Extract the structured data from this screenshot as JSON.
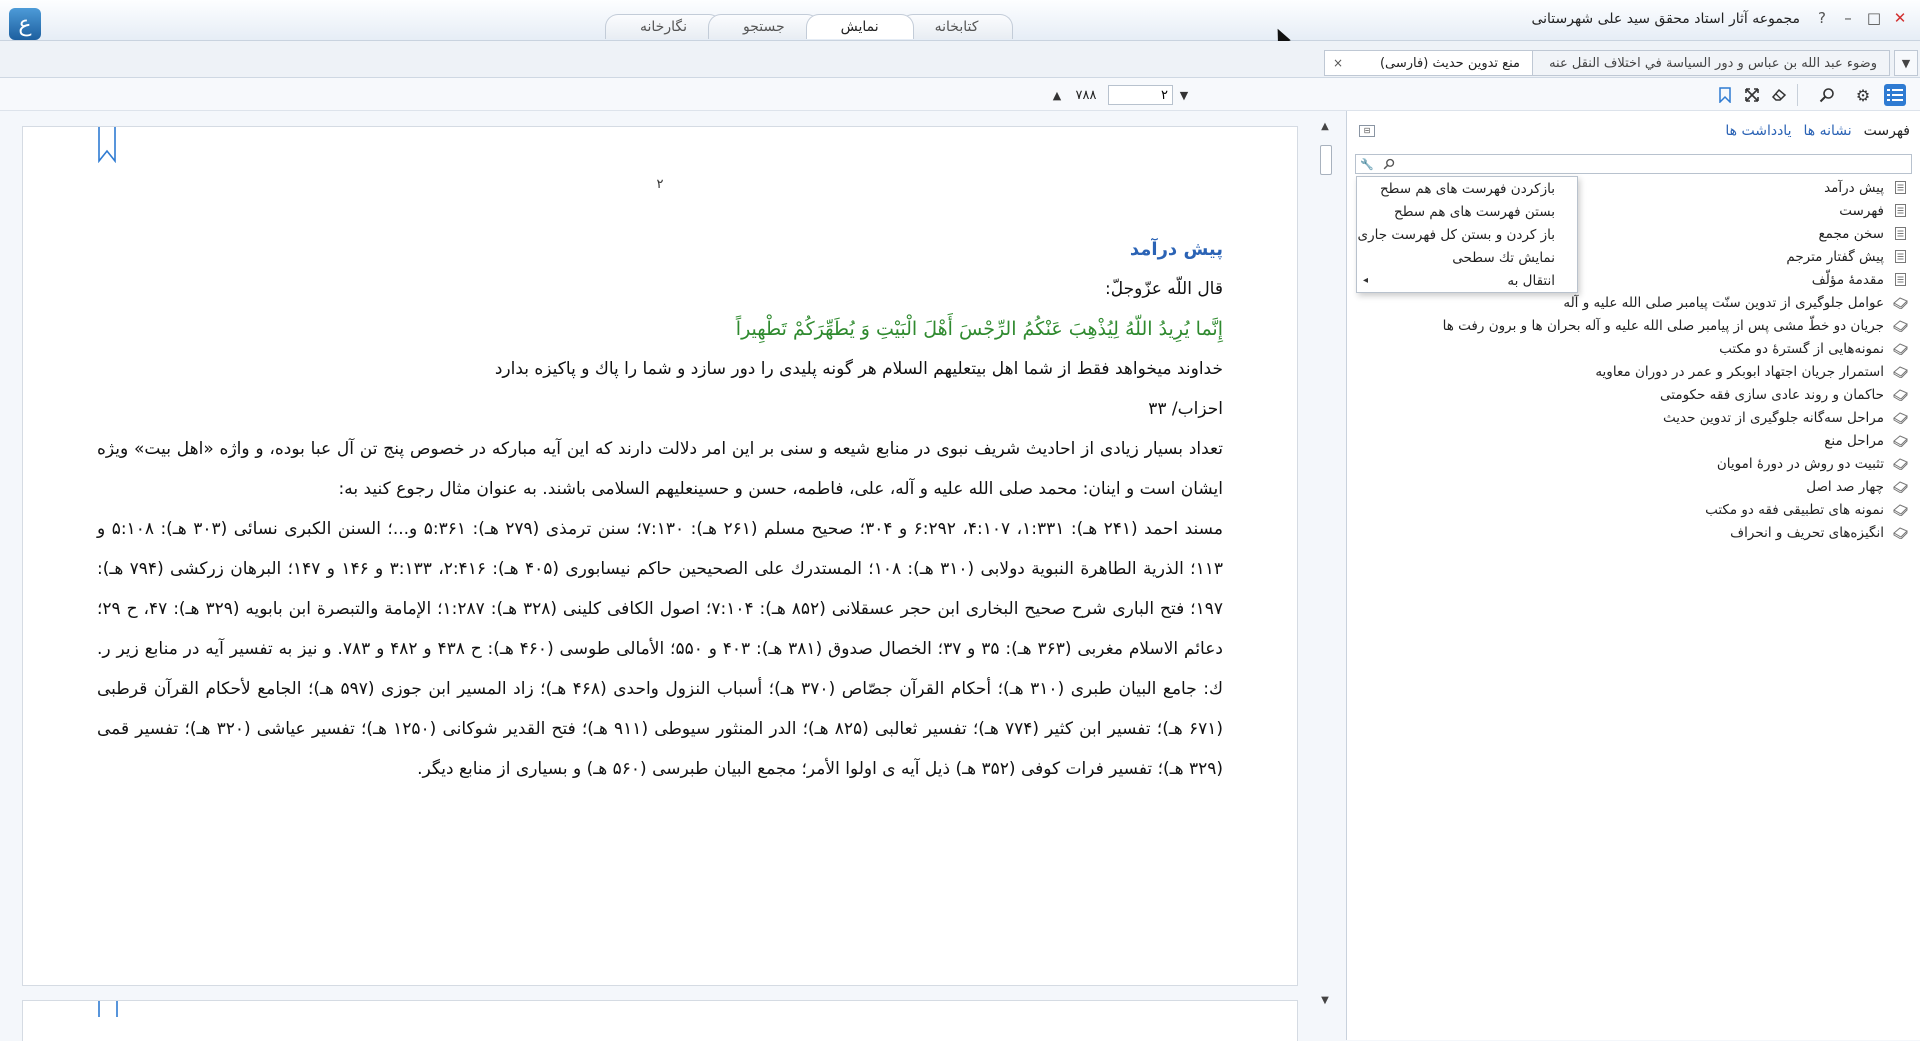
{
  "window": {
    "title": "مجموعه آثار استاد محقق سید علی شهرستانی",
    "logo_glyph": "ع",
    "controls": [
      "?",
      "–",
      "□",
      "✕"
    ]
  },
  "main_tabs": [
    {
      "label": "نگارخانه",
      "active": false
    },
    {
      "label": "جستجو",
      "active": false
    },
    {
      "label": "نمایش",
      "active": true
    },
    {
      "label": "کتابخانه",
      "active": false
    }
  ],
  "doc_tabs": [
    {
      "label": "وضوء عبد الله بن عباس و دور السياسة في اختلاف النقل عنه",
      "active": false
    },
    {
      "label": "منع تدوين حديث (فارسى)",
      "active": true,
      "close": "×"
    }
  ],
  "toolbar": {
    "icons": [
      "list-icon",
      "gear-icon",
      "search-icon",
      "eraser-icon",
      "fullscreen-icon",
      "bookmark-icon"
    ],
    "page_current": "۲",
    "page_total": "۷۸۸",
    "prev_glyph": "◂",
    "next_glyph": "▸"
  },
  "document": {
    "page_number": "۲",
    "heading": "پيش درآمد",
    "line1": "قال اللّه عزّوجلّ:",
    "quran": "إِنَّما يُرِيدُ اللّهُ لِيُذْهِبَ عَنْكُمُ الرِّجْسَ أَهْلَ الْبَيْتِ وَ يُطَهِّرَكُمْ تَطْهِيراً",
    "translation": "خداوند ميخواهد فقط از شما اهل بيتعليهم السلام هر گونه پليدى را دور سازد و شما را پاك و پاكيزه بدارد",
    "reference": "احزاب/ ۳۳",
    "paragraph1": "تعداد بسيار زيادى از احاديث شريف نبوى در منابع شيعه و سنى بر اين امر دلالت دارند كه اين آيه مباركه در خصوص پنج تن آل عبا بوده، و واژه «اهل بيت» ويژه ايشان است و اينان: محمد صلى الله عليه و آله، على، فاطمه، حسن و حسينعليهم السلامى باشند. به عنوان مثال رجوع كنيد به:",
    "paragraph2": "مسند احمد (۲۴۱ هـ): ۱:۳۳۱، ۴:۱۰۷، ۶:۲۹۲ و ۳۰۴؛ صحيح مسلم (۲۶۱ هـ): ۷:۱۳۰؛ سنن ترمذى (۲۷۹ هـ): ۵:۳۶۱ و...؛ السنن الكبرى نسائى (۳۰۳ هـ): ۵:۱۰۸ و ۱۱۳؛ الذرية الطاهرة النبوية دولابى (۳۱۰ هـ): ۱۰۸؛ المستدرك على الصحيحين حاكم نيسابورى (۴۰۵ هـ): ۲:۴۱۶، ۳:۱۳۳ و ۱۴۶ و ۱۴۷؛ البرهان زركشى (۷۹۴ هـ): ۱۹۷؛ فتح البارى شرح صحيح البخارى ابن حجر عسقلانى (۸۵۲ هـ): ۷:۱۰۴؛ اصول الكافى كلينى (۳۲۸ هـ): ۱:۲۸۷؛ الإمامة والتبصرة ابن بابويه (۳۲۹ هـ): ۴۷، ح ۲۹؛ دعائم الاسلام مغربى (۳۶۳ هـ): ۳۵ و ۳۷؛ الخصال صدوق (۳۸۱ هـ): ۴۰۳ و ۵۵۰؛ الأمالى طوسى (۴۶۰ هـ): ح ۴۳۸ و ۴۸۲ و ۷۸۳. و نيز به تفسير آيه در منابع زير ر. ك: جامع البيان طبرى (۳۱۰ هـ)؛ أحكام القرآن جصّاص (۳۷۰ هـ)؛ أسباب النزول واحدى (۴۶۸ هـ)؛ زاد المسير ابن جوزى (۵۹۷ هـ)؛ الجامع لأحكام القرآن قرطبى (۶۷۱ هـ)؛ تفسير ابن كثير (۷۷۴ هـ)؛ تفسير ثعالبى (۸۲۵ هـ)؛ الدر المنثور سيوطى (۹۱۱ هـ)؛ فتح القدير شوكانى (۱۲۵۰ هـ)؛ تفسير عياشى (۳۲۰ هـ)؛ تفسير قمى (۳۲۹ هـ)؛ تفسير فرات كوفى (۳۵۲ هـ) ذيل آيه ى اولوا الأمر؛ مجمع البيان طبرسى (۵۶۰ هـ) و بسيارى از منابع ديگر."
  },
  "right_panel": {
    "tabs": [
      {
        "label": "فهرست",
        "active": true
      },
      {
        "label": "نشانه ها",
        "active": false
      },
      {
        "label": "يادداشت ها",
        "active": false
      }
    ],
    "search_placeholder": "",
    "toc": [
      {
        "label": "پيش درآمد",
        "icon": "page-icon"
      },
      {
        "label": "فهرست",
        "icon": "page-icon"
      },
      {
        "label": "سخن مجمع",
        "icon": "page-icon"
      },
      {
        "label": "پيش گفتار مترجم",
        "icon": "page-icon"
      },
      {
        "label": "مقدمهٔ مؤلّف",
        "icon": "page-icon"
      },
      {
        "label": "عوامل جلوگيرى از تدوين سنّت پيامبر صلى الله عليه و آله",
        "icon": "folder-icon"
      },
      {
        "label": "جريان دو خطّ مشى پس از پيامبر صلى الله عليه و آله بحران ها و برون رفت ها",
        "icon": "folder-icon"
      },
      {
        "label": "نمونه‌هايى از گسترهٔ دو مكتب",
        "icon": "folder-icon"
      },
      {
        "label": "استمرار جريان اجتهاد ابوبكر و عمر در دوران معاويه",
        "icon": "folder-icon"
      },
      {
        "label": "حاكمان و روند عادى سازى فقه حكومتى",
        "icon": "folder-icon"
      },
      {
        "label": "مراحل سه‌گانه جلوگيرى از تدوين حديث",
        "icon": "folder-icon"
      },
      {
        "label": "مراحل منع",
        "icon": "folder-icon"
      },
      {
        "label": "تثبيت دو روش در دورهٔ امويان",
        "icon": "folder-icon"
      },
      {
        "label": "چهار صد اصل",
        "icon": "folder-icon"
      },
      {
        "label": "نمونه هاى تطبيقى فقه دو مكتب",
        "icon": "folder-icon"
      },
      {
        "label": "انگيزه‌هاى تحريف و انحراف",
        "icon": "folder-icon"
      }
    ],
    "context_menu": [
      {
        "label": "بازكردن فهرست هاى هم سطح"
      },
      {
        "label": "بستن فهرست هاى هم سطح"
      },
      {
        "label": "باز كردن و بستن كل فهرست جارى"
      },
      {
        "label": "نمايش تك سطحى"
      },
      {
        "label": "انتقال به",
        "submenu": "◂"
      }
    ]
  }
}
